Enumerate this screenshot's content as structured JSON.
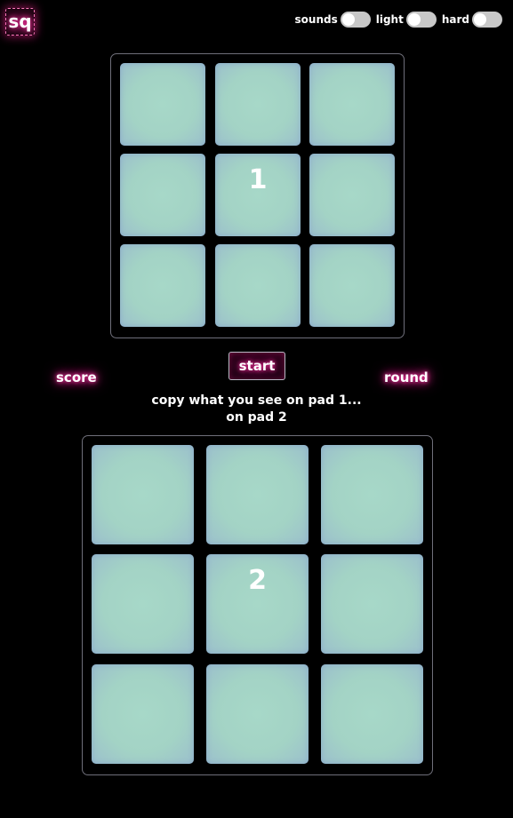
{
  "logo": {
    "text": "sq"
  },
  "toggles": [
    {
      "label": "sounds",
      "on": false
    },
    {
      "label": "light",
      "on": false
    },
    {
      "label": "hard",
      "on": false
    }
  ],
  "pad1": {
    "number": "1"
  },
  "pad2": {
    "number": "2"
  },
  "controls": {
    "start_label": "start",
    "score_label": "score",
    "round_label": "round"
  },
  "instructions": {
    "line1": "copy what you see on pad 1...",
    "line2": "on pad 2"
  },
  "colors": {
    "background": "#000000",
    "glow": "#ff2fa0",
    "cell": "#a3d3c5",
    "cell_edge": "#9bbfcc",
    "toggle_off": "#c8c8c8"
  }
}
